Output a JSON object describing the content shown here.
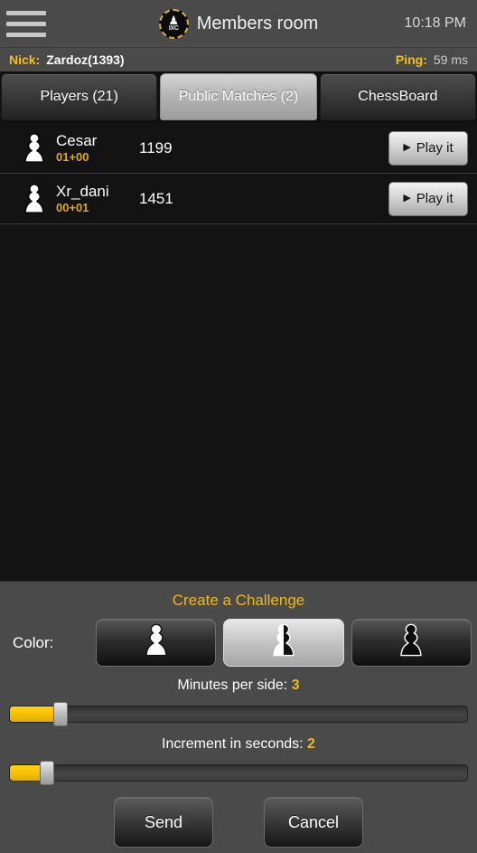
{
  "titlebar": {
    "menu_icon": "hamburger-menu-icon",
    "logo_glyph": "♟",
    "logo_text": "IXC",
    "title": "Members room",
    "clock": "10:18 PM"
  },
  "infostrip": {
    "nick_label": "Nick:",
    "nick_value": "Zardoz(1393)",
    "ping_label": "Ping:",
    "ping_value": "59 ms",
    "gold": "#f0c020"
  },
  "tabs": [
    {
      "label": "Players (21)",
      "active": false
    },
    {
      "label": "Public Matches (2)",
      "active": true
    },
    {
      "label": "ChessBoard",
      "active": false
    }
  ],
  "matches": {
    "rows": [
      {
        "icon": "white-pawn-icon",
        "name": "Cesar",
        "time_control": "01+00",
        "rating": "1199",
        "action": "Play it"
      },
      {
        "icon": "white-pawn-icon",
        "name": "Xr_dani",
        "time_control": "00+01",
        "rating": "1451",
        "action": "Play it"
      }
    ]
  },
  "challenge": {
    "title": "Create a Challenge",
    "color_label": "Color:",
    "color_options": [
      {
        "id": "white",
        "icon": "white-pawn-icon",
        "selected": false
      },
      {
        "id": "random",
        "icon": "half-white-half-black-pawn-icon",
        "selected": true
      },
      {
        "id": "black",
        "icon": "black-pawn-icon",
        "selected": false
      }
    ],
    "minutes": {
      "label": "Minutes per side:",
      "value": "3",
      "fill_percent": 10,
      "thumb_percent": 10
    },
    "increment": {
      "label": "Increment in seconds:",
      "value": "2",
      "fill_percent": 7,
      "thumb_percent": 7
    },
    "send_label": "Send",
    "cancel_label": "Cancel",
    "accent": "#f0b818"
  }
}
